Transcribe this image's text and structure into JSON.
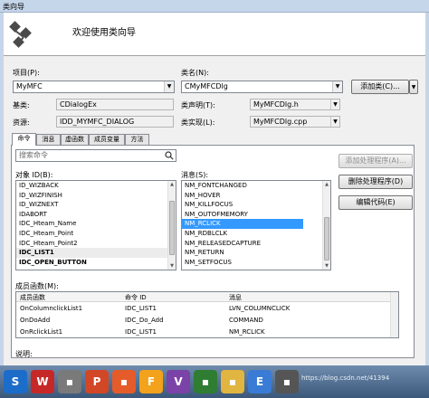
{
  "window": {
    "title": "类向导"
  },
  "header": {
    "title": "欢迎使用类向导"
  },
  "project": {
    "label": "项目(P):",
    "value": "MyMFC"
  },
  "classname": {
    "label": "类名(N):",
    "value": "CMyMFCDlg"
  },
  "add_class": {
    "label": "添加类(C)..."
  },
  "base_class": {
    "label": "基类:",
    "value": "CDialogEx"
  },
  "resource": {
    "label": "资源:",
    "value": "IDD_MYMFC_DIALOG"
  },
  "class_decl": {
    "label": "类声明(T):",
    "value": "MyMFCDlg.h"
  },
  "class_impl": {
    "label": "类实现(L):",
    "value": "MyMFCDlg.cpp"
  },
  "tabs": [
    {
      "label": "命令"
    },
    {
      "label": "消息"
    },
    {
      "label": "虚函数"
    },
    {
      "label": "成员变量"
    },
    {
      "label": "方法"
    }
  ],
  "search": {
    "placeholder": "搜索命令"
  },
  "object_ids": {
    "label": "对象 ID(B):",
    "items": [
      "ID_WIZBACK",
      "ID_WIZFINISH",
      "ID_WIZNEXT",
      "IDABORT",
      "IDC_Hteam_Name",
      "IDC_Hteam_Point",
      "IDC_Hteam_Point2",
      "IDC_LIST1",
      "IDC_OPEN_BUTTON"
    ]
  },
  "messages": {
    "label": "消息(S):",
    "items": [
      "NM_FONTCHANGED",
      "NM_HOVER",
      "NM_KILLFOCUS",
      "NM_OUTOFMEMORY",
      "NM_RCLICK",
      "NM_RDBLCLK",
      "NM_RELEASEDCAPTURE",
      "NM_RETURN",
      "NM_SETFOCUS"
    ],
    "selected_index": 4
  },
  "buttons": {
    "add_handler": "添加处理程序(A)...",
    "delete_handler": "删除处理程序(D)",
    "edit_code": "编辑代码(E)"
  },
  "member_functions": {
    "label": "成员函数(M):",
    "columns": [
      "成员函数",
      "命令 ID",
      "消息"
    ],
    "rows": [
      [
        "OnColumnclickList1",
        "IDC_LIST1",
        "LVN_COLUMNCLICK"
      ],
      [
        "OnDoAdd",
        "IDC_Do_Add",
        "COMMAND"
      ],
      [
        "OnRclickList1",
        "IDC_LIST1",
        "NM_RCLICK"
      ]
    ]
  },
  "description": {
    "label": "说明:"
  },
  "taskbar": {
    "apps": [
      "S",
      "W",
      "P",
      "F",
      "V",
      "E"
    ],
    "tray_text": "https://blog.csdn.net/41394"
  },
  "colors": {
    "selection": "#3399ff",
    "taskbar": "#4a6a8e"
  }
}
